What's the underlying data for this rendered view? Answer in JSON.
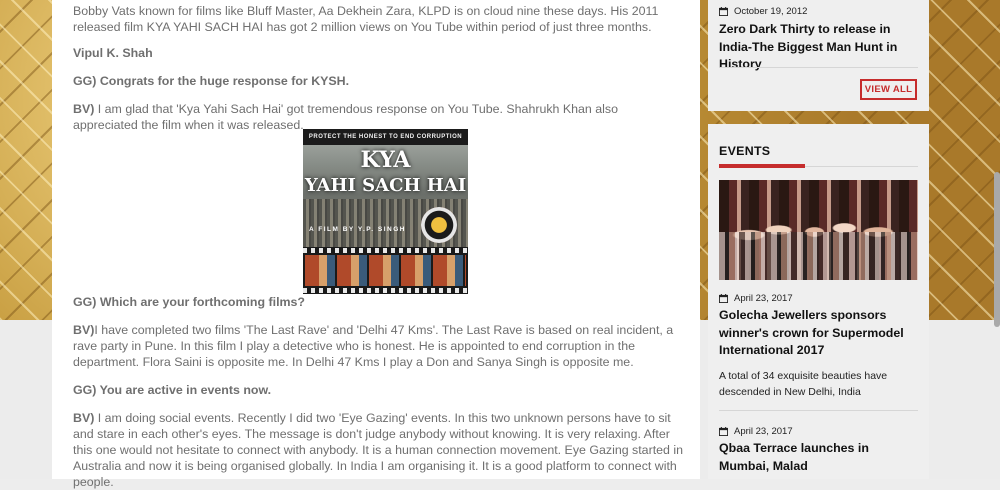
{
  "article": {
    "intro": "Bobby Vats known for films like Bluff Master, Aa Dekhein Zara, KLPD is on cloud nine these days. His 2011 released film KYA YAHI SACH HAI has got 2 million views on You Tube within period of just three months.",
    "byline": "Vipul K. Shah",
    "q1": "GG) Congrats for the huge response for KYSH.",
    "a1_prefix": "BV)",
    "a1": " I am glad that 'Kya Yahi Sach Hai' got tremendous response on You Tube. Shahrukh Khan also appreciated the film when it was released.",
    "poster": {
      "tagline": "PROTECT THE HONEST TO END CORRUPTION",
      "title_line1": "KYA",
      "title_line2": "YAHI SACH HAI",
      "credit": "A FILM BY Y.P. SINGH"
    },
    "q2": "GG) Which are your forthcoming films?",
    "a2_prefix": "BV)",
    "a2": "I have completed two films 'The Last Rave' and 'Delhi 47 Kms'. The Last Rave is based on real incident, a rave party in Pune. In this film I play a detective who is honest. He is appointed to end corruption in the department. Flora Saini is opposite me. In Delhi 47 Kms I play a Don and Sanya Singh is opposite me.",
    "q3": "GG) You are active in events now.",
    "a3_prefix": "BV)",
    "a3": " I am doing social events. Recently I did two 'Eye Gazing' events. In this two unknown persons have to sit and stare in each other's eyes. The message is don't judge anybody without knowing. It is very relaxing. After this one would not hesitate to connect with anybody. It is a human connection movement. Eye Gazing started in Australia and now it is being organised globally. In India I am organising it. It is a good platform to connect with people."
  },
  "sidebar": {
    "news": {
      "date": "October 19, 2012",
      "headline": "Zero Dark Thirty to release in India-The Biggest Man Hunt in History",
      "view_all": "VIEW ALL"
    },
    "events": {
      "title": "EVENTS",
      "items": [
        {
          "date": "April 23, 2017",
          "headline": "Golecha Jewellers sponsors winner's crown for Supermodel International 2017",
          "summary": "A total of 34 exquisite beauties have descended in New Delhi, India"
        },
        {
          "date": "April 23, 2017",
          "headline": "Qbaa Terrace launches in Mumbai, Malad"
        }
      ]
    }
  },
  "colors": {
    "accent": "#c62d2d",
    "body_text": "#6f6f6f",
    "sidebar_bg": "#efefef"
  },
  "icons": {
    "date": "calendar-icon"
  }
}
